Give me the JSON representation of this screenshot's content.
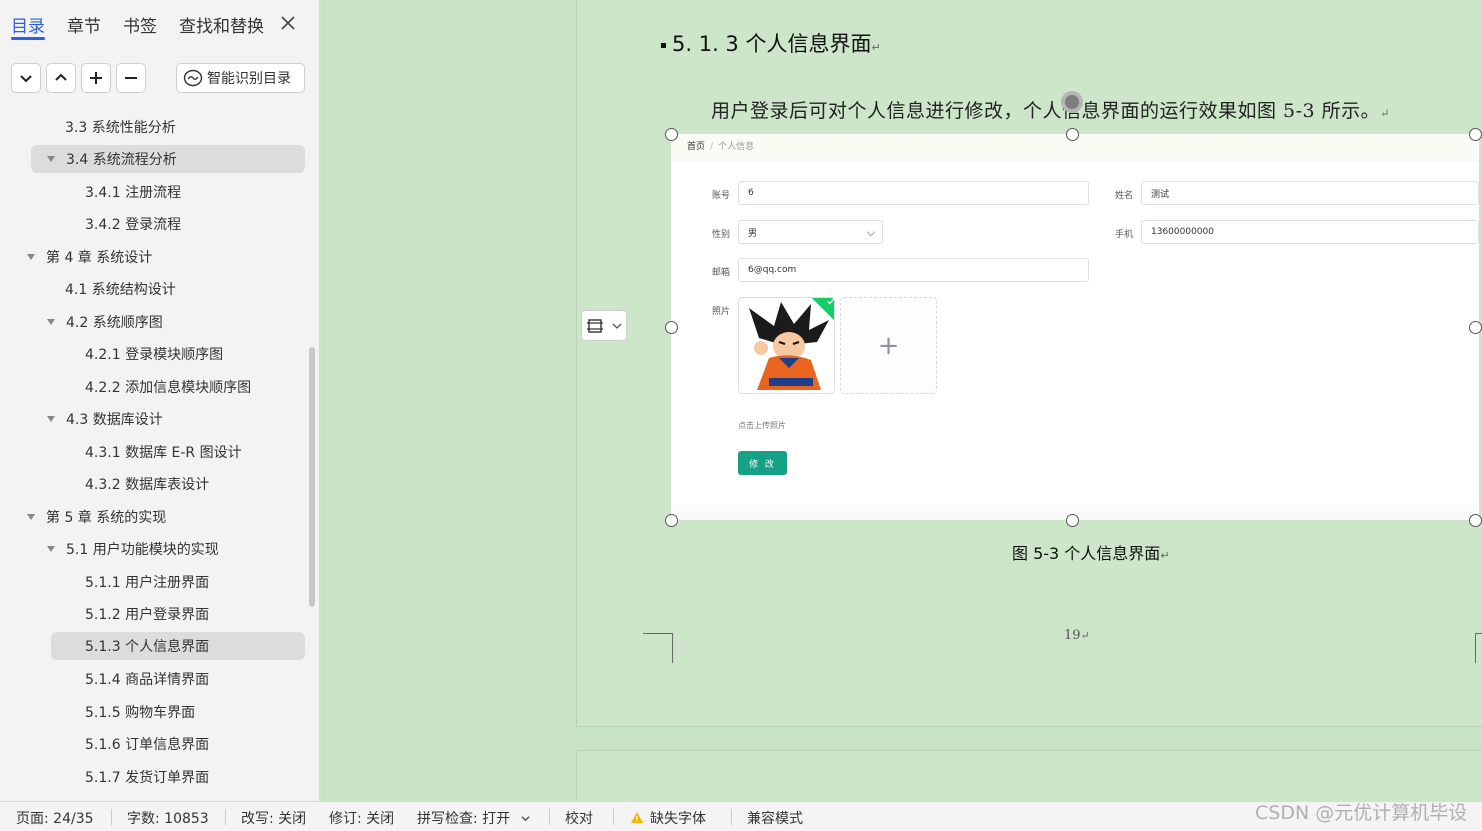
{
  "sidebar": {
    "tabs": [
      "目录",
      "章节",
      "书签",
      "查找和替换"
    ],
    "smart_toc_label": "智能识别目录",
    "toc": [
      {
        "label": "3.3  系统性能分析"
      },
      {
        "label": "3.4  系统流程分析"
      },
      {
        "label": "3.4.1 注册流程"
      },
      {
        "label": "3.4.2 登录流程"
      },
      {
        "label": "第 4 章    系统设计"
      },
      {
        "label": "4.1  系统结构设计"
      },
      {
        "label": "4.2 系统顺序图"
      },
      {
        "label": "4.2.1 登录模块顺序图"
      },
      {
        "label": "4.2.2 添加信息模块顺序图"
      },
      {
        "label": "4.3  数据库设计"
      },
      {
        "label": "4.3.1  数据库 E-R 图设计"
      },
      {
        "label": "4.3.2 数据库表设计"
      },
      {
        "label": "第 5 章    系统的实现"
      },
      {
        "label": "5.1  用户功能模块的实现"
      },
      {
        "label": "5.1.1 用户注册界面"
      },
      {
        "label": "5.1.2 用户登录界面"
      },
      {
        "label": "5.1.3 个人信息界面"
      },
      {
        "label": "5.1.4 商品详情界面"
      },
      {
        "label": "5.1.5 购物车界面"
      },
      {
        "label": "5.1.6 订单信息界面"
      },
      {
        "label": "5.1.7 发货订单界面"
      }
    ]
  },
  "document": {
    "heading": "5. 1. 3 个人信息界面",
    "paragraph": "用户登录后可对个人信息进行修改，个人信息界面的运行效果如图 5-3 所示。",
    "caption": "图 5-3 个人信息界面",
    "page_number": "19",
    "screenshot": {
      "breadcrumb_home": "首页",
      "breadcrumb_sep": "/",
      "breadcrumb_current": "个人信息",
      "account_label": "账号",
      "account_value": "6",
      "name_label": "姓名",
      "name_value": "测试",
      "gender_label": "性别",
      "gender_value": "男",
      "phone_label": "手机",
      "phone_value": "13600000000",
      "email_label": "邮箱",
      "email_value": "6@qq.com",
      "photo_label": "照片",
      "upload_hint": "点击上传照片",
      "modify_button": "修 改"
    }
  },
  "statusbar": {
    "page": "页面: 24/35",
    "words": "字数: 10853",
    "rewrite": "改写: 关闭",
    "revision": "修订: 关闭",
    "spellcheck": "拼写检查: 打开",
    "proof": "校对",
    "missing_fonts": "缺失字体",
    "compat": "兼容模式"
  },
  "watermark": "CSDN @元优计算机毕设",
  "colors": {
    "accent": "#2d62d8",
    "doc_background": "#cde6c9",
    "button_teal": "#16a085"
  }
}
